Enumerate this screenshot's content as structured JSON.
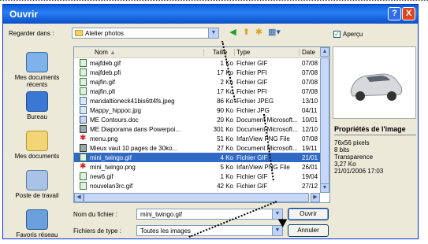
{
  "window": {
    "title": "Ouvrir",
    "help": "?",
    "close": "X"
  },
  "lookin": {
    "label": "Regarder dans :",
    "value": "Atelier photos"
  },
  "toolbar": {
    "back": "back-icon",
    "up": "up-folder-icon",
    "new_folder": "new-folder-icon",
    "views": "views-icon"
  },
  "preview_toggle": {
    "label": "Aperçu",
    "checked": true
  },
  "places": [
    {
      "label": "Mes documents récents",
      "icon": "recent-documents-icon"
    },
    {
      "label": "Bureau",
      "icon": "desktop-icon"
    },
    {
      "label": "Mes documents",
      "icon": "my-documents-icon"
    },
    {
      "label": "Poste de travail",
      "icon": "my-computer-icon"
    },
    {
      "label": "Favoris réseau",
      "icon": "network-places-icon"
    }
  ],
  "columns": {
    "name": "Nom",
    "size": "Taille",
    "type": "Type",
    "date": "Date"
  },
  "files": [
    {
      "name": "majfdeb.gif",
      "size": "1 Ko",
      "type": "Fichier GIF",
      "date": "07/08",
      "kind": "gif"
    },
    {
      "name": "majfdeb.pfi",
      "size": "17 Ko",
      "type": "Fichier PFI",
      "date": "07/08",
      "kind": "gif"
    },
    {
      "name": "majfin.gif",
      "size": "2 Ko",
      "type": "Fichier GIF",
      "date": "07/08",
      "kind": "gif"
    },
    {
      "name": "majfin.pfi",
      "size": "17 Ko",
      "type": "Fichier PFI",
      "date": "07/08",
      "kind": "gif"
    },
    {
      "name": "mandaltioneck41bis6tt4fs.jpeg",
      "size": "86 Ko",
      "type": "Fichier JPEG",
      "date": "13/10",
      "kind": "jpg"
    },
    {
      "name": "Mappy_hippoc.jpg",
      "size": "90 Ko",
      "type": "Fichier JPG",
      "date": "04/11",
      "kind": "jpg"
    },
    {
      "name": "ME Contours.doc",
      "size": "20 Ko",
      "type": "Document Microsoft...",
      "date": "10/01",
      "kind": "doc"
    },
    {
      "name": "ME Diaporama dans Powerpoi...",
      "size": "301 Ko",
      "type": "Document Microsoft...",
      "date": "12/10",
      "kind": "pps"
    },
    {
      "name": "menu.png",
      "size": "51 Ko",
      "type": "IrfanView PNG File",
      "date": "07/08",
      "kind": "png"
    },
    {
      "name": "Mieux vaut 10 pages de 30ko...",
      "size": "27 Ko",
      "type": "Document Microsoft...",
      "date": "19/11",
      "kind": "pps"
    },
    {
      "name": "mini_twingo.gif",
      "size": "4 Ko",
      "type": "Fichier GIF",
      "date": "21/01",
      "kind": "gif",
      "selected": true
    },
    {
      "name": "mini_twingo.png",
      "size": "5 Ko",
      "type": "IrfanView PNG File",
      "date": "26/01",
      "kind": "png"
    },
    {
      "name": "new6.gif",
      "size": "1 Ko",
      "type": "Fichier GIF",
      "date": "19/04",
      "kind": "gif"
    },
    {
      "name": "nouvelan3rc.gif",
      "size": "42 Ko",
      "type": "Fichier GIF",
      "date": "27/12",
      "kind": "gif"
    }
  ],
  "properties": {
    "title": "Propriétés de l'image",
    "lines": [
      "76x56 pixels",
      "8 bits",
      "Transparence",
      "3,27 Ko",
      "21/01/2006 17:03"
    ]
  },
  "filename": {
    "label": "Nom du fichier :",
    "value": "mini_twingo.gif"
  },
  "filetype": {
    "label": "Fichiers de type :",
    "value": "Toutes les images"
  },
  "buttons": {
    "open": "Ouvrir",
    "cancel": "Annuler"
  }
}
